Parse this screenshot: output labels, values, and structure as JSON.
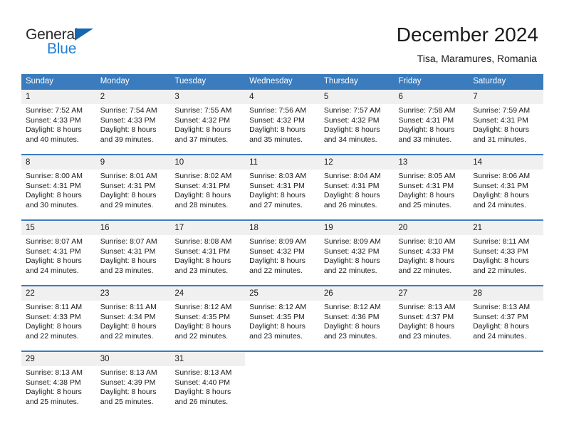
{
  "brand": {
    "name_dark": "General",
    "name_blue": "Blue",
    "triangle_color": "#1567b2",
    "blue_color": "#1f7fd4"
  },
  "header": {
    "title": "December 2024",
    "subtitle": "Tisa, Maramures, Romania"
  },
  "calendar": {
    "header_bg": "#3a7cbe",
    "daynum_bg": "#f0f0f0",
    "weekday_headers": [
      "Sunday",
      "Monday",
      "Tuesday",
      "Wednesday",
      "Thursday",
      "Friday",
      "Saturday"
    ],
    "weeks": [
      [
        {
          "day": "1",
          "sunrise": "Sunrise: 7:52 AM",
          "sunset": "Sunset: 4:33 PM",
          "daylight_line1": "Daylight: 8 hours",
          "daylight_line2": "and 40 minutes."
        },
        {
          "day": "2",
          "sunrise": "Sunrise: 7:54 AM",
          "sunset": "Sunset: 4:33 PM",
          "daylight_line1": "Daylight: 8 hours",
          "daylight_line2": "and 39 minutes."
        },
        {
          "day": "3",
          "sunrise": "Sunrise: 7:55 AM",
          "sunset": "Sunset: 4:32 PM",
          "daylight_line1": "Daylight: 8 hours",
          "daylight_line2": "and 37 minutes."
        },
        {
          "day": "4",
          "sunrise": "Sunrise: 7:56 AM",
          "sunset": "Sunset: 4:32 PM",
          "daylight_line1": "Daylight: 8 hours",
          "daylight_line2": "and 35 minutes."
        },
        {
          "day": "5",
          "sunrise": "Sunrise: 7:57 AM",
          "sunset": "Sunset: 4:32 PM",
          "daylight_line1": "Daylight: 8 hours",
          "daylight_line2": "and 34 minutes."
        },
        {
          "day": "6",
          "sunrise": "Sunrise: 7:58 AM",
          "sunset": "Sunset: 4:31 PM",
          "daylight_line1": "Daylight: 8 hours",
          "daylight_line2": "and 33 minutes."
        },
        {
          "day": "7",
          "sunrise": "Sunrise: 7:59 AM",
          "sunset": "Sunset: 4:31 PM",
          "daylight_line1": "Daylight: 8 hours",
          "daylight_line2": "and 31 minutes."
        }
      ],
      [
        {
          "day": "8",
          "sunrise": "Sunrise: 8:00 AM",
          "sunset": "Sunset: 4:31 PM",
          "daylight_line1": "Daylight: 8 hours",
          "daylight_line2": "and 30 minutes."
        },
        {
          "day": "9",
          "sunrise": "Sunrise: 8:01 AM",
          "sunset": "Sunset: 4:31 PM",
          "daylight_line1": "Daylight: 8 hours",
          "daylight_line2": "and 29 minutes."
        },
        {
          "day": "10",
          "sunrise": "Sunrise: 8:02 AM",
          "sunset": "Sunset: 4:31 PM",
          "daylight_line1": "Daylight: 8 hours",
          "daylight_line2": "and 28 minutes."
        },
        {
          "day": "11",
          "sunrise": "Sunrise: 8:03 AM",
          "sunset": "Sunset: 4:31 PM",
          "daylight_line1": "Daylight: 8 hours",
          "daylight_line2": "and 27 minutes."
        },
        {
          "day": "12",
          "sunrise": "Sunrise: 8:04 AM",
          "sunset": "Sunset: 4:31 PM",
          "daylight_line1": "Daylight: 8 hours",
          "daylight_line2": "and 26 minutes."
        },
        {
          "day": "13",
          "sunrise": "Sunrise: 8:05 AM",
          "sunset": "Sunset: 4:31 PM",
          "daylight_line1": "Daylight: 8 hours",
          "daylight_line2": "and 25 minutes."
        },
        {
          "day": "14",
          "sunrise": "Sunrise: 8:06 AM",
          "sunset": "Sunset: 4:31 PM",
          "daylight_line1": "Daylight: 8 hours",
          "daylight_line2": "and 24 minutes."
        }
      ],
      [
        {
          "day": "15",
          "sunrise": "Sunrise: 8:07 AM",
          "sunset": "Sunset: 4:31 PM",
          "daylight_line1": "Daylight: 8 hours",
          "daylight_line2": "and 24 minutes."
        },
        {
          "day": "16",
          "sunrise": "Sunrise: 8:07 AM",
          "sunset": "Sunset: 4:31 PM",
          "daylight_line1": "Daylight: 8 hours",
          "daylight_line2": "and 23 minutes."
        },
        {
          "day": "17",
          "sunrise": "Sunrise: 8:08 AM",
          "sunset": "Sunset: 4:31 PM",
          "daylight_line1": "Daylight: 8 hours",
          "daylight_line2": "and 23 minutes."
        },
        {
          "day": "18",
          "sunrise": "Sunrise: 8:09 AM",
          "sunset": "Sunset: 4:32 PM",
          "daylight_line1": "Daylight: 8 hours",
          "daylight_line2": "and 22 minutes."
        },
        {
          "day": "19",
          "sunrise": "Sunrise: 8:09 AM",
          "sunset": "Sunset: 4:32 PM",
          "daylight_line1": "Daylight: 8 hours",
          "daylight_line2": "and 22 minutes."
        },
        {
          "day": "20",
          "sunrise": "Sunrise: 8:10 AM",
          "sunset": "Sunset: 4:33 PM",
          "daylight_line1": "Daylight: 8 hours",
          "daylight_line2": "and 22 minutes."
        },
        {
          "day": "21",
          "sunrise": "Sunrise: 8:11 AM",
          "sunset": "Sunset: 4:33 PM",
          "daylight_line1": "Daylight: 8 hours",
          "daylight_line2": "and 22 minutes."
        }
      ],
      [
        {
          "day": "22",
          "sunrise": "Sunrise: 8:11 AM",
          "sunset": "Sunset: 4:33 PM",
          "daylight_line1": "Daylight: 8 hours",
          "daylight_line2": "and 22 minutes."
        },
        {
          "day": "23",
          "sunrise": "Sunrise: 8:11 AM",
          "sunset": "Sunset: 4:34 PM",
          "daylight_line1": "Daylight: 8 hours",
          "daylight_line2": "and 22 minutes."
        },
        {
          "day": "24",
          "sunrise": "Sunrise: 8:12 AM",
          "sunset": "Sunset: 4:35 PM",
          "daylight_line1": "Daylight: 8 hours",
          "daylight_line2": "and 22 minutes."
        },
        {
          "day": "25",
          "sunrise": "Sunrise: 8:12 AM",
          "sunset": "Sunset: 4:35 PM",
          "daylight_line1": "Daylight: 8 hours",
          "daylight_line2": "and 23 minutes."
        },
        {
          "day": "26",
          "sunrise": "Sunrise: 8:12 AM",
          "sunset": "Sunset: 4:36 PM",
          "daylight_line1": "Daylight: 8 hours",
          "daylight_line2": "and 23 minutes."
        },
        {
          "day": "27",
          "sunrise": "Sunrise: 8:13 AM",
          "sunset": "Sunset: 4:37 PM",
          "daylight_line1": "Daylight: 8 hours",
          "daylight_line2": "and 23 minutes."
        },
        {
          "day": "28",
          "sunrise": "Sunrise: 8:13 AM",
          "sunset": "Sunset: 4:37 PM",
          "daylight_line1": "Daylight: 8 hours",
          "daylight_line2": "and 24 minutes."
        }
      ],
      [
        {
          "day": "29",
          "sunrise": "Sunrise: 8:13 AM",
          "sunset": "Sunset: 4:38 PM",
          "daylight_line1": "Daylight: 8 hours",
          "daylight_line2": "and 25 minutes."
        },
        {
          "day": "30",
          "sunrise": "Sunrise: 8:13 AM",
          "sunset": "Sunset: 4:39 PM",
          "daylight_line1": "Daylight: 8 hours",
          "daylight_line2": "and 25 minutes."
        },
        {
          "day": "31",
          "sunrise": "Sunrise: 8:13 AM",
          "sunset": "Sunset: 4:40 PM",
          "daylight_line1": "Daylight: 8 hours",
          "daylight_line2": "and 26 minutes."
        },
        {
          "day": "",
          "sunrise": "",
          "sunset": "",
          "daylight_line1": "",
          "daylight_line2": ""
        },
        {
          "day": "",
          "sunrise": "",
          "sunset": "",
          "daylight_line1": "",
          "daylight_line2": ""
        },
        {
          "day": "",
          "sunrise": "",
          "sunset": "",
          "daylight_line1": "",
          "daylight_line2": ""
        },
        {
          "day": "",
          "sunrise": "",
          "sunset": "",
          "daylight_line1": "",
          "daylight_line2": ""
        }
      ]
    ]
  }
}
